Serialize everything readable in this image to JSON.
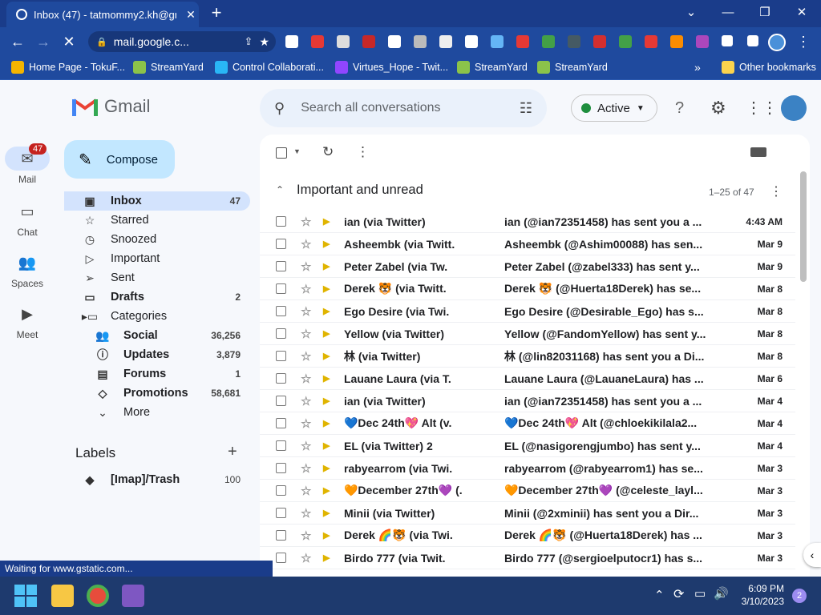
{
  "browser": {
    "tab_title": "Inbox (47) - tatmommy2.kh@gm",
    "url": "mail.google.c...",
    "status": "Waiting for www.gstatic.com..."
  },
  "bookmarks": [
    {
      "label": "Home Page - TokuF...",
      "color": "#f4b400"
    },
    {
      "label": "StreamYard",
      "color": "#8bc34a"
    },
    {
      "label": "Control Collaborati...",
      "color": "#29b6f6"
    },
    {
      "label": "Virtues_Hope - Twit...",
      "color": "#9146ff"
    },
    {
      "label": "StreamYard",
      "color": "#8bc34a"
    },
    {
      "label": "StreamYard",
      "color": "#8bc34a"
    }
  ],
  "other_bookmarks": "Other bookmarks",
  "gmail": {
    "logo": "Gmail",
    "search_placeholder": "Search all conversations",
    "status": "Active",
    "compose": "Compose",
    "rail": {
      "mail": "Mail",
      "mail_badge": "47",
      "chat": "Chat",
      "spaces": "Spaces",
      "meet": "Meet"
    },
    "labels_heading": "Labels",
    "section_title": "Important and unread",
    "range": "1–25 of 47"
  },
  "nav": [
    {
      "label": "Inbox",
      "count": "47",
      "icon": "inbox-icon",
      "glyph": "▣",
      "bold": true
    },
    {
      "label": "Starred",
      "count": "",
      "icon": "star-icon",
      "glyph": "☆",
      "bold": false
    },
    {
      "label": "Snoozed",
      "count": "",
      "icon": "clock-icon",
      "glyph": "◷",
      "bold": false
    },
    {
      "label": "Important",
      "count": "",
      "icon": "important-icon",
      "glyph": "▷",
      "bold": false
    },
    {
      "label": "Sent",
      "count": "",
      "icon": "send-icon",
      "glyph": "➢",
      "bold": false
    },
    {
      "label": "Drafts",
      "count": "2",
      "icon": "draft-icon",
      "glyph": "▭",
      "bold": true
    },
    {
      "label": "Categories",
      "count": "",
      "icon": "label-icon",
      "glyph": "▸▭",
      "bold": false
    },
    {
      "label": "Social",
      "count": "36,256",
      "icon": "people-icon",
      "glyph": "👥",
      "bold": true,
      "indent": true
    },
    {
      "label": "Updates",
      "count": "3,879",
      "icon": "info-icon",
      "glyph": "ⓘ",
      "bold": true,
      "indent": true
    },
    {
      "label": "Forums",
      "count": "1",
      "icon": "forum-icon",
      "glyph": "▤",
      "bold": true,
      "indent": true
    },
    {
      "label": "Promotions",
      "count": "58,681",
      "icon": "tag-icon",
      "glyph": "◇",
      "bold": true,
      "indent": true
    },
    {
      "label": "More",
      "count": "",
      "icon": "chevron-down-icon",
      "glyph": "⌄",
      "bold": false,
      "indent": true
    }
  ],
  "label_items": [
    {
      "label": "[Imap]/Trash",
      "count": "100"
    }
  ],
  "emails": [
    {
      "sender": "ian (via Twitter)",
      "subject": "ian (@ian72351458) has sent you a ...",
      "date": "4:43 AM"
    },
    {
      "sender": "Asheembk (via Twitt.",
      "subject": "Asheembk (@Ashim00088) has sen...",
      "date": "Mar 9"
    },
    {
      "sender": "Peter Zabel (via Tw.",
      "subject": "Peter Zabel (@zabel333) has sent y...",
      "date": "Mar 9"
    },
    {
      "sender": "Derek 🐯 (via Twitt.",
      "subject": "Derek 🐯 (@Huerta18Derek) has se...",
      "date": "Mar 8"
    },
    {
      "sender": "Ego Desire (via Twi.",
      "subject": "Ego Desire (@Desirable_Ego) has s...",
      "date": "Mar 8"
    },
    {
      "sender": "Yellow (via Twitter)",
      "subject": "Yellow (@FandomYellow) has sent y...",
      "date": "Mar 8"
    },
    {
      "sender": "林 (via Twitter)",
      "subject": "林 (@lin82031168) has sent you a Di...",
      "date": "Mar 8"
    },
    {
      "sender": "Lauane Laura (via T.",
      "subject": "Lauane Laura (@LauaneLaura) has ...",
      "date": "Mar 6"
    },
    {
      "sender": "ian (via Twitter)",
      "subject": "ian (@ian72351458) has sent you a ...",
      "date": "Mar 4"
    },
    {
      "sender": "💙Dec 24th💖 Alt (v.",
      "subject": "💙Dec 24th💖 Alt (@chloekikilala2...",
      "date": "Mar 4"
    },
    {
      "sender": "EL (via Twitter) 2",
      "subject": "EL (@nasigorengjumbo) has sent y...",
      "date": "Mar 4"
    },
    {
      "sender": "rabyearrom (via Twi.",
      "subject": "rabyearrom (@rabyearrom1) has se...",
      "date": "Mar 3"
    },
    {
      "sender": "🧡December 27th💜 (.",
      "subject": "🧡December 27th💜 (@celeste_layl...",
      "date": "Mar 3"
    },
    {
      "sender": "Minii (via Twitter)",
      "subject": "Minii (@2xminii) has sent you a Dir...",
      "date": "Mar 3"
    },
    {
      "sender": "Derek 🌈🐯 (via Twi.",
      "subject": "Derek 🌈🐯 (@Huerta18Derek) has ...",
      "date": "Mar 3"
    },
    {
      "sender": "Birdo 777 (via Twit.",
      "subject": "Birdo 777 (@sergioelputocr1) has s...",
      "date": "Mar 3"
    }
  ],
  "taskbar": {
    "time": "6:09 PM",
    "date": "3/10/2023",
    "notif": "2"
  }
}
